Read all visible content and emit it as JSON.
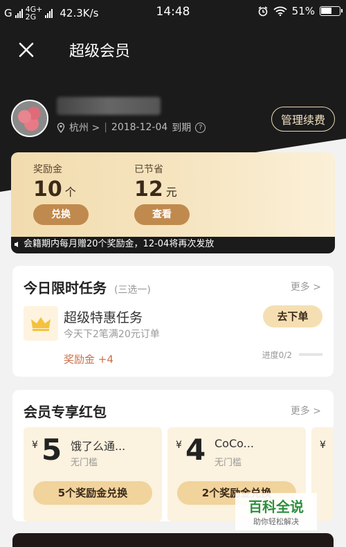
{
  "status_bar": {
    "carrier_left": "G",
    "network": [
      "4G+",
      "2G"
    ],
    "speed": "42.3K/s",
    "time": "14:48",
    "battery": "51%"
  },
  "nav": {
    "title": "超级会员"
  },
  "user": {
    "location": "杭州 >",
    "expire_date": "2018-12-04",
    "expire_suffix": "到期",
    "manage_label": "管理续费"
  },
  "benefits": {
    "reward_label": "奖励金",
    "reward_value": "10",
    "reward_unit": "个",
    "reward_btn": "兑换",
    "saved_label": "已节省",
    "saved_value": "12",
    "saved_unit": "元",
    "saved_btn": "查看"
  },
  "notice": "会籍期内每月赠20个奖励金，12-04将再次发放",
  "tasks": {
    "title": "今日限时任务",
    "subtitle": "(三选一)",
    "more": "更多 >",
    "item_title": "超级特惠任务",
    "item_desc": "今天下2笔满20元订单",
    "item_reward": "奖励金 +4",
    "action": "去下单",
    "progress": "进度0/2"
  },
  "coupons": {
    "title": "会员专享红包",
    "more": "更多 >",
    "items": [
      {
        "amount": "5",
        "currency": "¥",
        "name": "饿了么通...",
        "cond": "无门槛",
        "exchange": "5个奖励金兑换"
      },
      {
        "amount": "4",
        "currency": "¥",
        "name": "CoCo...",
        "cond": "无门槛",
        "exchange": "2个奖励金兑换"
      }
    ]
  },
  "watermark": {
    "title": "百科全说",
    "subtitle": "助你轻松解决"
  },
  "colors": {
    "accent_gold": "#c08a4e",
    "dark_bg": "#1b1b1b",
    "reward_text": "#c9704a"
  }
}
